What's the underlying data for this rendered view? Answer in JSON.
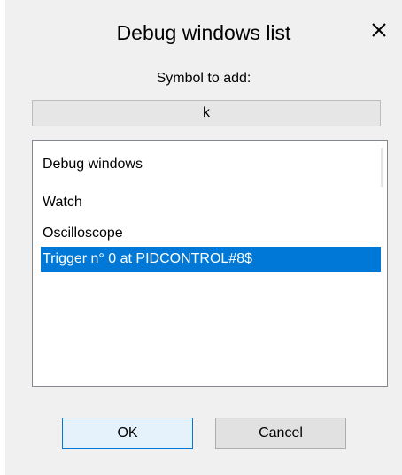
{
  "dialog": {
    "title": "Debug windows list",
    "close_icon": "close-icon"
  },
  "symbol": {
    "label": "Symbol to add:",
    "value": "k"
  },
  "list": {
    "header": "Debug windows",
    "items": [
      {
        "label": "Watch",
        "selected": false
      },
      {
        "label": "Oscilloscope",
        "selected": false
      },
      {
        "label": "Trigger n° 0 at PIDCONTROL#8$",
        "selected": true
      }
    ],
    "selection_color": "#0078d7"
  },
  "buttons": {
    "ok_label": "OK",
    "cancel_label": "Cancel"
  }
}
